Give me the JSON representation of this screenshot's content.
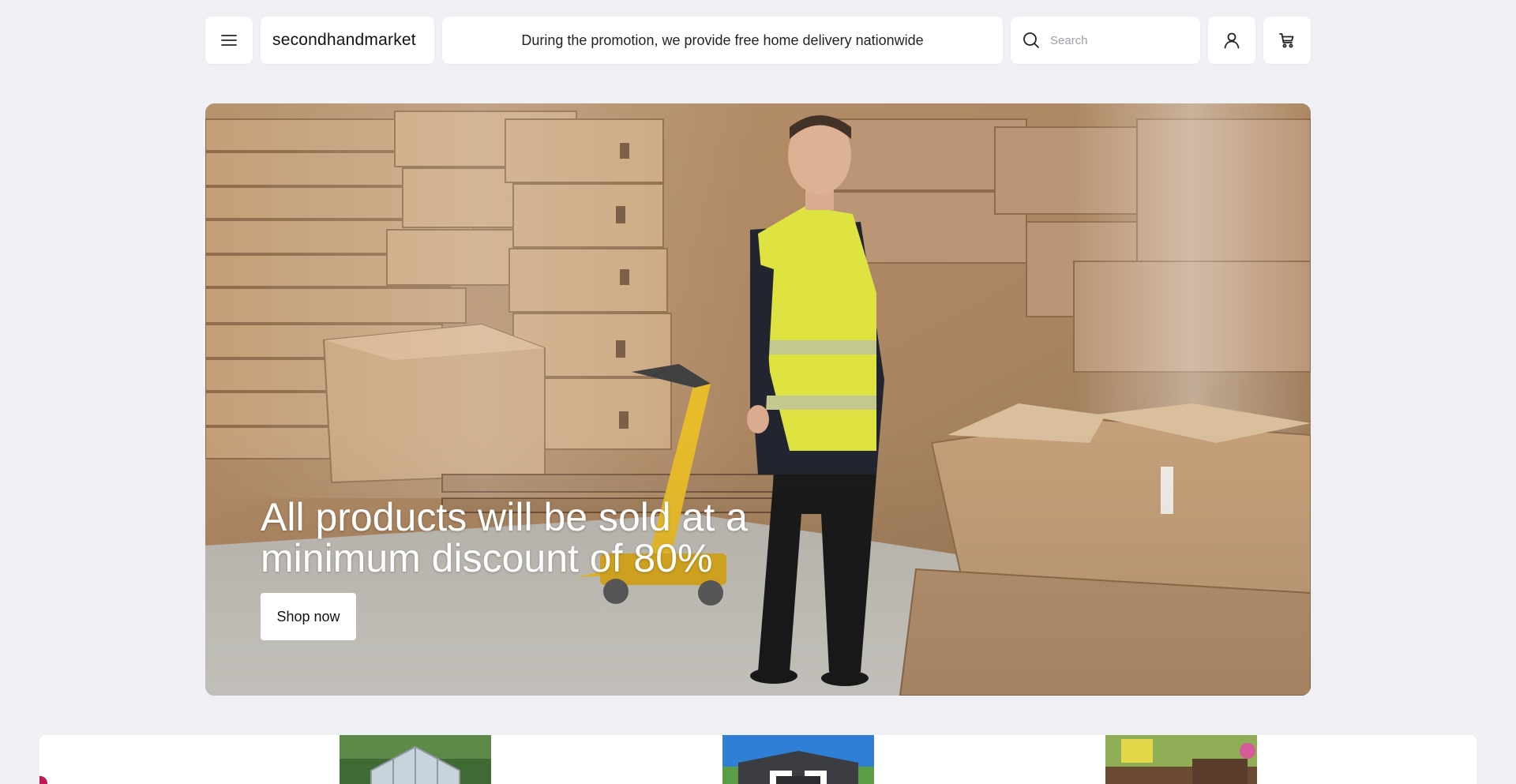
{
  "header": {
    "menu_icon": "hamburger-menu-icon",
    "logo": "secondhandmarket",
    "promo": "During the promotion, we provide free home delivery nationwide",
    "search": {
      "placeholder": "Search",
      "value": "",
      "icon": "search-icon"
    },
    "account_icon": "user-icon",
    "cart_icon": "cart-icon"
  },
  "hero": {
    "heading": "All products will be sold at a minimum discount of 80%",
    "cta_label": "Shop now",
    "image": "warehouse-worker-with-pallet-jack-and-stacked-cardboard-boxes"
  },
  "categories": [
    {
      "image": "greenhouse"
    },
    {
      "image": "garden-shed"
    },
    {
      "image": "garden-furniture"
    }
  ],
  "colors": {
    "page_bg": "#eef0f4",
    "surface": "#ffffff",
    "accent": "#c2185b"
  }
}
